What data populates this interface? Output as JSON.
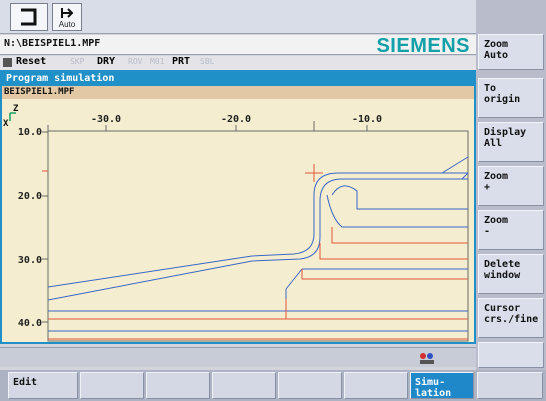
{
  "header": {
    "mode_label": "Auto",
    "program_path": "N:\\BEISPIEL1.MPF",
    "brand": "SIEMENS"
  },
  "status": {
    "reset": "Reset",
    "skp": "SKP",
    "dry": "DRY",
    "rov": "ROV",
    "m01": "M01",
    "prt": "PRT",
    "sbl": "SBL"
  },
  "simulation": {
    "title": "Program simulation",
    "file": "BEISPIEL1.MPF",
    "axis_z": "Z",
    "axis_x": "X",
    "x_ticks": [
      "-30.0",
      "-20.0",
      "-10.0"
    ],
    "y_ticks": [
      "10.0",
      "20.0",
      "30.0",
      "40.0"
    ]
  },
  "vsoftkeys": [
    {
      "label": "Zoom\nAuto"
    },
    {
      "label": "To\norigin"
    },
    {
      "label": "Display\nAll"
    },
    {
      "label": "Zoom\n+"
    },
    {
      "label": "Zoom\n-"
    },
    {
      "label": "Delete\nwindow"
    },
    {
      "label": "Cursor\ncrs./fine"
    }
  ],
  "hsoftkeys": {
    "edit": "Edit",
    "simulation": "Simu-\nlation"
  },
  "colors": {
    "accent": "#2090c8",
    "brand": "#14a0a8",
    "contour_blue": "#3a66c8",
    "contour_red": "#e0553a"
  }
}
